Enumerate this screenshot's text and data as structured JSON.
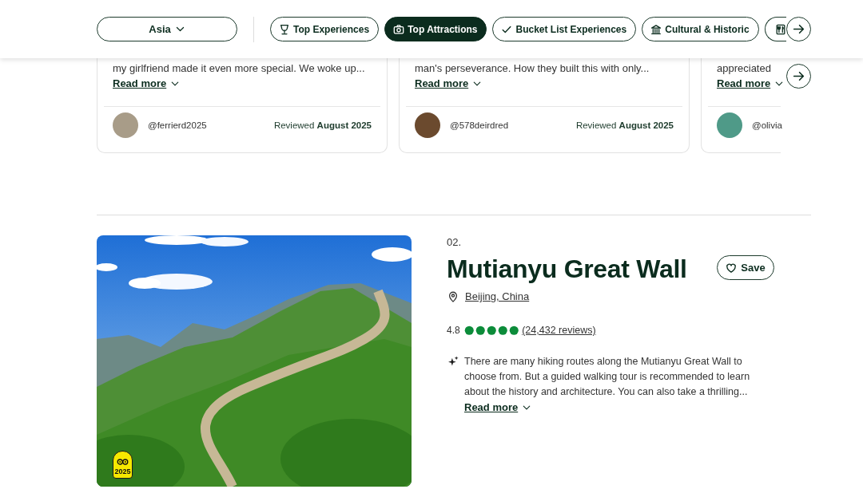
{
  "header": {
    "region_dropdown": {
      "value": "Asia"
    },
    "filter_chips": [
      {
        "label": "Top Experiences",
        "selected": false
      },
      {
        "label": "Top Attractions",
        "selected": true
      },
      {
        "label": "Bucket List Experiences",
        "selected": false
      },
      {
        "label": "Cultural & Historic",
        "selected": false
      },
      {
        "selected": false
      }
    ]
  },
  "review_cards": [
    {
      "text": "my girlfriend made it even more special. We woke up...",
      "link": "Read more",
      "user": "@ferrierd2025",
      "reviewed": "Reviewed **August 2025**"
    },
    {
      "text": "man's perseverance. How they built this with only...",
      "link": "Read more",
      "user": "@578deirdred",
      "reviewed": "Reviewed **August 2025**"
    },
    {
      "text": "appreciated",
      "link": "Read more",
      "user": "@olivia"
    }
  ],
  "attraction": {
    "number": "02.",
    "title": "Mutianyu Great Wall",
    "save_button": "Save",
    "location": "Beijing, China",
    "rating": "4.8",
    "stars": 5,
    "reviews": "(24,432 reviews)",
    "summary": "There are many hiking routes along the Mutianyu Great Wall to choose from. But a guided walking tour is recommended to learn about the history and architecture. You can also take a thrilling...",
    "link": "Read more",
    "badge": "2025"
  }
}
